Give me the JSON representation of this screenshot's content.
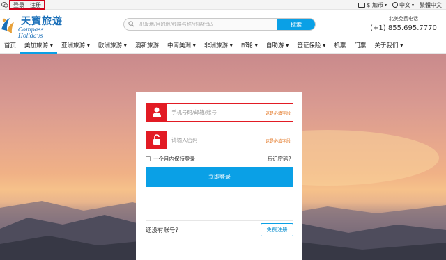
{
  "topbar": {
    "auth": {
      "login": "登录",
      "register": "注册"
    },
    "currency": "$ 加币",
    "language": "中文",
    "script_toggle": "繁體中文"
  },
  "header": {
    "logo_cn": "天寳旅遊",
    "logo_en": "Compass Holidays",
    "search": {
      "placeholder": "出发地/目的地/线路名称/线路代码",
      "button": "搜索"
    },
    "phone": {
      "label": "北美免费电话",
      "number": "(+1) 855.695.7770"
    }
  },
  "nav": {
    "items": [
      {
        "label": "首页"
      },
      {
        "label": "美加旅游 ▾"
      },
      {
        "label": "亚洲旅游 ▾"
      },
      {
        "label": "欧洲旅游 ▾"
      },
      {
        "label": "澳新旅游"
      },
      {
        "label": "中南美洲 ▾"
      },
      {
        "label": "非洲旅游 ▾"
      },
      {
        "label": "邮轮 ▾"
      },
      {
        "label": "自助游 ▾"
      },
      {
        "label": "签证保险 ▾"
      },
      {
        "label": "机票"
      },
      {
        "label": "门票"
      },
      {
        "label": "关于我们 ▾"
      }
    ]
  },
  "login": {
    "username_placeholder": "手机号码/邮箱/账号",
    "username_error": "这是必填字段",
    "password_placeholder": "请输入密码",
    "password_error": "这是必填字段",
    "remember": "一个月内保持登录",
    "forgot": "忘记密码？",
    "submit": "立即登录",
    "no_account": "还没有账号？",
    "register": "免费注册"
  },
  "colors": {
    "accent": "#0aa0e6",
    "error": "#e21b24",
    "highlight_box": "#d0021b"
  }
}
